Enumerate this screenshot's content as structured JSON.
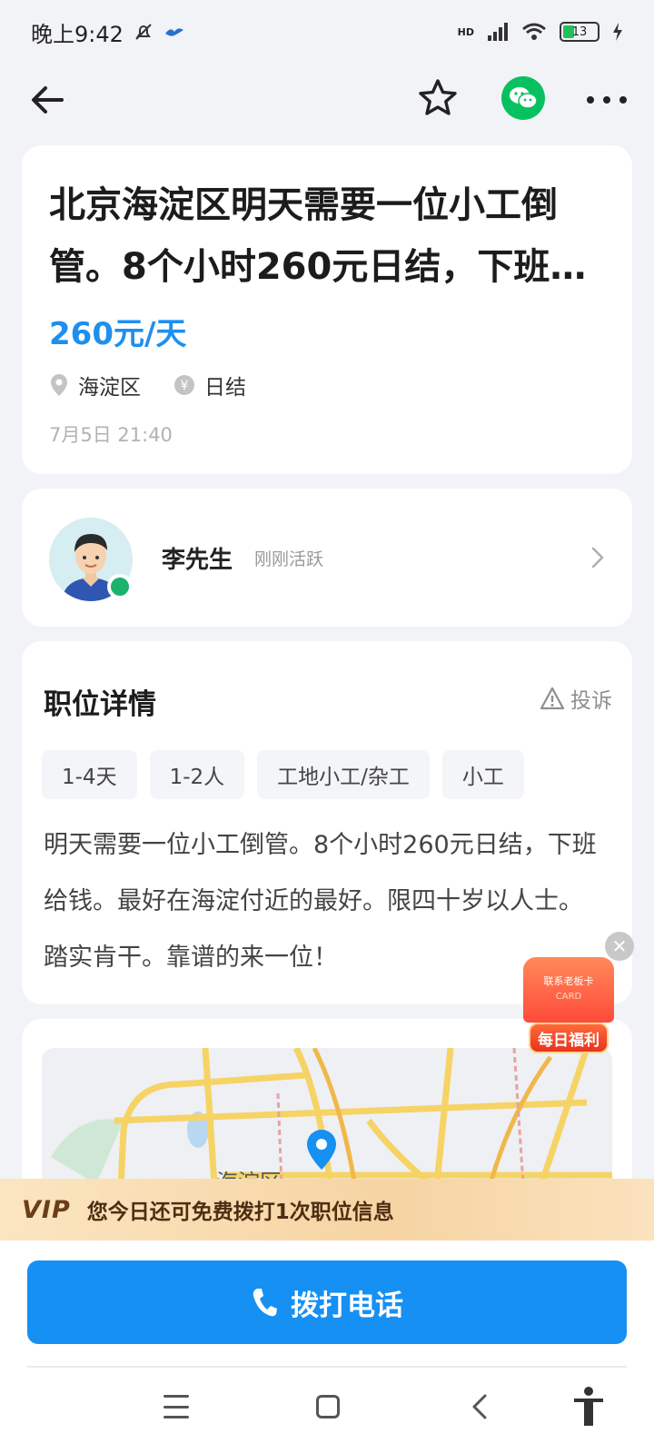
{
  "status_bar": {
    "time": "晚上9:42",
    "network": "HD",
    "battery": "13"
  },
  "nav": {
    "back_icon": "back-arrow-icon",
    "favorite_icon": "star-icon",
    "share_icon": "wechat-icon",
    "more_icon": "more-dots-icon"
  },
  "job": {
    "title": "北京海淀区明天需要一位小工倒管。8个小时260元日结，下班给钱。最好在海淀付近的最好。限四十岁以人士。踏实肯干。靠谱的来一位！",
    "salary": "260元/天",
    "location": "海淀区",
    "pay_cycle": "日结",
    "posted_at": "7月5日 21:40"
  },
  "poster": {
    "name": "李先生",
    "status": "刚刚活跃"
  },
  "details": {
    "section_title": "职位详情",
    "report_label": "投诉",
    "tags": [
      "1-4天",
      "1-2人",
      "工地小工/杂工",
      "小工"
    ],
    "description": "明天需要一位小工倒管。8个小时260元日结，下班给钱。最好在海淀付近的最好。限四十岁以人士。踏实肯干。靠谱的来一位！"
  },
  "map": {
    "district_label": "海淀区"
  },
  "promo": {
    "top_text": "联系老板卡",
    "card_text": "CARD",
    "label": "每日福利"
  },
  "vip": {
    "logo": "VIP",
    "message": "您今日还可免费拨打1次职位信息"
  },
  "actions": {
    "call_label": "拨打电话"
  },
  "colors": {
    "accent": "#1790f3",
    "salary": "#1e8ff0",
    "online": "#1bb26b",
    "wechat": "#07c160"
  }
}
